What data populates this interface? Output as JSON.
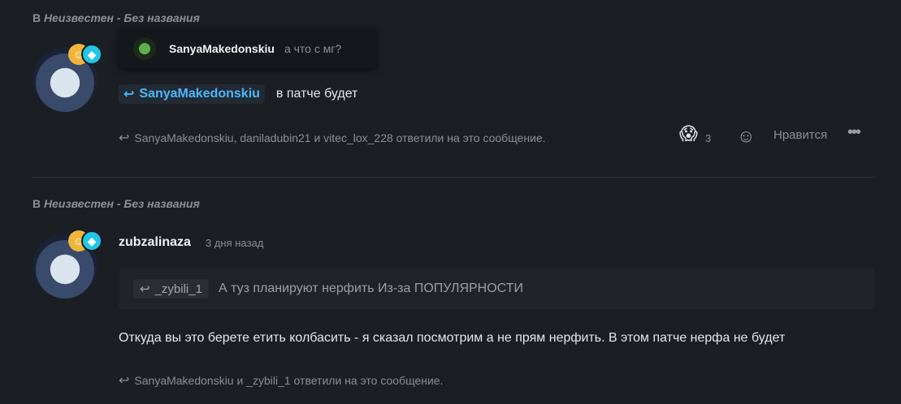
{
  "post1": {
    "context_prefix": "В",
    "context_game": "Неизвестен - Без названия",
    "quote_author": "SanyaMakedonskiu",
    "quote_text": "а что с мг?",
    "mention": "SanyaMakedonskiu",
    "message": "в патче будет",
    "replies": "SanyaMakedonskiu, daniladubin21 и vitec_lox_228 ответили на это сообщение.",
    "reaction_emoji": "😱",
    "reaction_count": "3",
    "like_label": "Нравится",
    "more_label": "•••"
  },
  "post2": {
    "context_prefix": "В",
    "context_game": "Неизвестен - Без названия",
    "author": "zubzalinaza",
    "time": "3 дня назад",
    "quote_author": "_zybili_1",
    "quote_text": "А туз планируют нерфить Из-за ПОПУЛЯРНОСТИ",
    "message": "Откуда вы это берете етить колбасить - я сказал посмотрим а не прям нерфить. В этом патче нерфа не будет",
    "replies": "SanyaMakedonskiu и _zybili_1 ответили на это сообщение."
  },
  "icons": {
    "reply": "↩",
    "badge_gold": "☺",
    "badge_cyan": "◆",
    "add_reaction": "☺+"
  }
}
